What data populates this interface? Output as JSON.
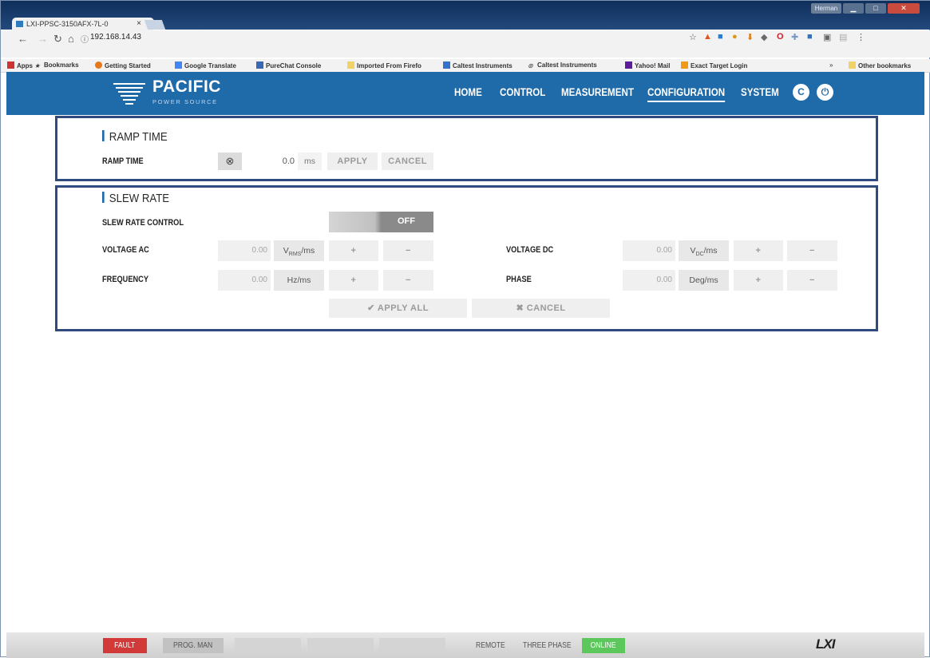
{
  "browser": {
    "tab_title": "LXI-PPSC-3150AFX-7L-0",
    "tab_close": "×",
    "user_label": "Herman",
    "url": "192.168.14.43",
    "bookmarks": [
      "Apps",
      "Bookmarks",
      "Getting Started",
      "Google Translate",
      "PureChat Console",
      "Imported From Firefo",
      "Caltest Instruments",
      "Caltest Instruments",
      "Yahoo! Mail",
      "Exact Target Login",
      "»",
      "Other bookmarks"
    ]
  },
  "header": {
    "logo_main": "PACIFIC",
    "logo_sub": "POWER SOURCE",
    "menu": [
      "HOME",
      "CONTROL",
      "MEASUREMENT",
      "CONFIGURATION",
      "SYSTEM"
    ],
    "active_menu": "CONFIGURATION",
    "refresh_icon": "C",
    "power_icon": "⏻"
  },
  "ramp": {
    "section_title": "RAMP TIME",
    "label": "RAMP TIME",
    "clear_icon": "⊗",
    "value": "0.0",
    "unit": "ms",
    "apply": "APPLY",
    "cancel": "CANCEL"
  },
  "slew": {
    "section_title": "SLEW RATE",
    "control_label": "SLEW RATE CONTROL",
    "toggle_state": "OFF",
    "voltage_ac": {
      "label": "VOLTAGE AC",
      "value": "0.00",
      "unit_main": "V",
      "unit_sub": "RMS",
      "unit_tail": "/ms",
      "plus": "+",
      "minus": "−"
    },
    "frequency": {
      "label": "FREQUENCY",
      "value": "0.00",
      "unit": "Hz/ms",
      "plus": "+",
      "minus": "−"
    },
    "voltage_dc": {
      "label": "VOLTAGE DC",
      "value": "0.00",
      "unit_main": "V",
      "unit_sub": "DC",
      "unit_tail": "/ms",
      "plus": "+",
      "minus": "−"
    },
    "phase": {
      "label": "PHASE",
      "value": "0.00",
      "unit": "Deg/ms",
      "plus": "+",
      "minus": "−"
    },
    "apply_all": "✔ APPLY ALL",
    "cancel": "✖ CANCEL"
  },
  "statusbar": {
    "fault": "FAULT",
    "prog_man": "PROG. MAN",
    "remote": "REMOTE",
    "three_phase": "THREE PHASE",
    "online": "ONLINE",
    "logo": "LXI"
  },
  "colors": {
    "header_blue": "#1f6aa9",
    "fault_red": "#d23a3a",
    "online_green": "#5cc85c",
    "panel_border": "#2f4a7e"
  }
}
